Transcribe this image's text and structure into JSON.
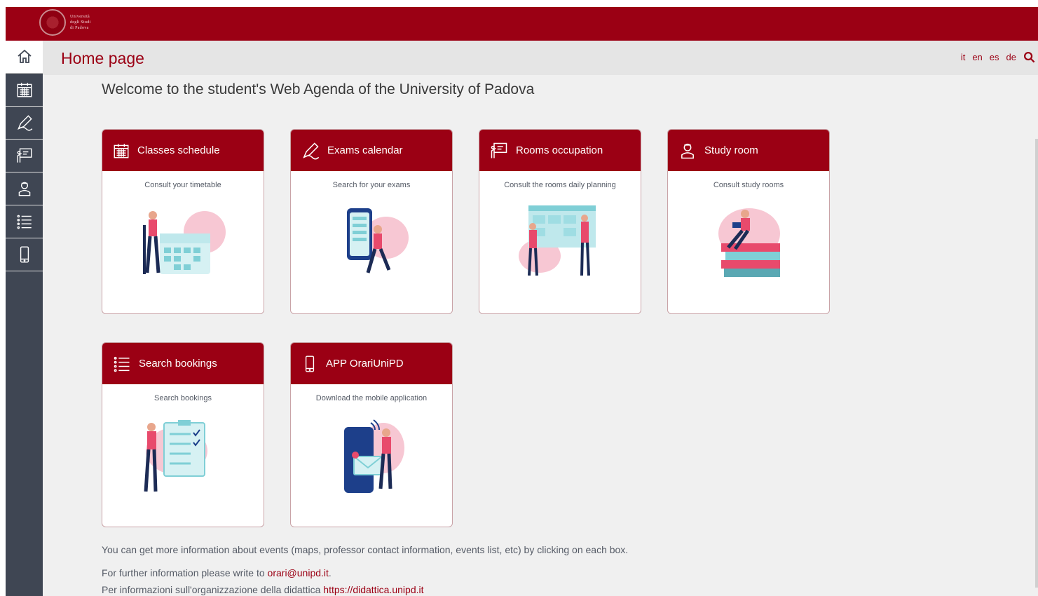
{
  "topbar": {
    "logo_lines": [
      "Università",
      "degli Studi",
      "di Padova"
    ],
    "brand_color": "#9b0014"
  },
  "sidebar": {
    "items": [
      {
        "icon": "home-icon",
        "active": true
      },
      {
        "icon": "calendar-icon",
        "active": false
      },
      {
        "icon": "pen-icon",
        "active": false
      },
      {
        "icon": "board-icon",
        "active": false
      },
      {
        "icon": "student-icon",
        "active": false
      },
      {
        "icon": "list-icon",
        "active": false
      },
      {
        "icon": "mobile-icon",
        "active": false
      }
    ]
  },
  "header": {
    "title": "Home page",
    "languages": [
      "it",
      "en",
      "es",
      "de"
    ],
    "search_icon": "search-icon"
  },
  "welcome": "Welcome to the student's Web Agenda of the University of Padova",
  "cards": [
    {
      "title": "Classes schedule",
      "subtitle": "Consult your timetable",
      "icon": "calendar-icon"
    },
    {
      "title": "Exams calendar",
      "subtitle": "Search for your exams",
      "icon": "pen-icon"
    },
    {
      "title": "Rooms occupation",
      "subtitle": "Consult the rooms daily planning",
      "icon": "board-icon"
    },
    {
      "title": "Study room",
      "subtitle": "Consult study rooms",
      "icon": "student-icon"
    },
    {
      "title": "Search bookings",
      "subtitle": "Search bookings",
      "icon": "list-icon"
    },
    {
      "title": "APP OrariUniPD",
      "subtitle": "Download the mobile application",
      "icon": "mobile-icon"
    }
  ],
  "info": {
    "events": "You can get more information about events (maps, professor contact information, events list, etc) by clicking on each box.",
    "contact_prefix": "For further information please write to ",
    "contact_email": "orari@unipd.it",
    "contact_suffix": ".",
    "didattica_prefix": "Per informazioni sull'organizzazione della didattica ",
    "didattica_link": "https://didattica.unipd.it"
  }
}
